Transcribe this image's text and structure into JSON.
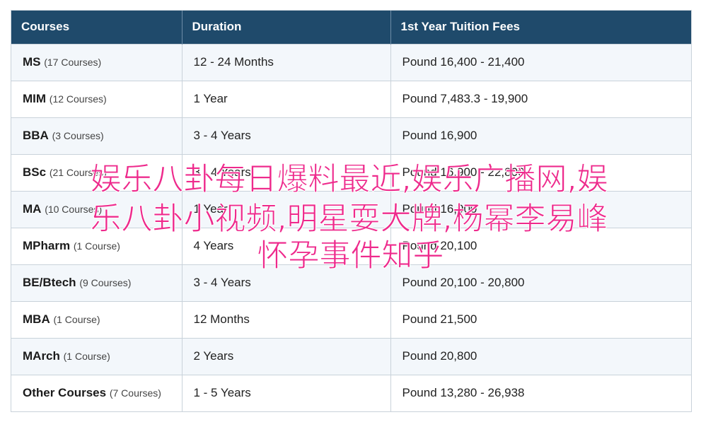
{
  "table": {
    "headers": [
      "Courses",
      "Duration",
      "1st Year Tuition Fees"
    ],
    "rows": [
      {
        "course": "MS",
        "count": "(17 Courses)",
        "duration": "12 - 24 Months",
        "fees": "Pound 16,400 - 21,400"
      },
      {
        "course": "MIM",
        "count": "(12 Courses)",
        "duration": "1 Year",
        "fees": "Pound 7,483.3 - 19,900"
      },
      {
        "course": "BBA",
        "count": "(3 Courses)",
        "duration": "3 - 4 Years",
        "fees": "Pound 16,900"
      },
      {
        "course": "BSc",
        "count": "(21 Courses)",
        "duration": "3 - 4 Years",
        "fees": "Pound 16,900 - 22,800"
      },
      {
        "course": "MA",
        "count": "(10 Courses)",
        "duration": "1 Year",
        "fees": "Pound 16,900"
      },
      {
        "course": "MPharm",
        "count": "(1 Course)",
        "duration": "4 Years",
        "fees": "Pound 20,100"
      },
      {
        "course": "BE/Btech",
        "count": "(9 Courses)",
        "duration": "3 - 4 Years",
        "fees": "Pound 20,100 - 20,800"
      },
      {
        "course": "MBA",
        "count": "(1 Course)",
        "duration": "12 Months",
        "fees": "Pound 21,500"
      },
      {
        "course": "MArch",
        "count": "(1 Course)",
        "duration": "2 Years",
        "fees": "Pound 20,800"
      },
      {
        "course": "Other Courses",
        "count": "(7 Courses)",
        "duration": "1 - 5 Years",
        "fees": "Pound 13,280 - 26,938"
      }
    ]
  },
  "overlay": {
    "line1": "娱乐八卦每日爆料最近,娱乐广播网,娱",
    "line2": "乐八卦小视频,明星耍大牌,杨幂李易峰",
    "line3": "怀孕事件知乎"
  },
  "colors": {
    "header_bg": "#1f4a6b",
    "row_alt_bg": "#f3f7fb",
    "overlay_text": "#ee2a8c"
  }
}
